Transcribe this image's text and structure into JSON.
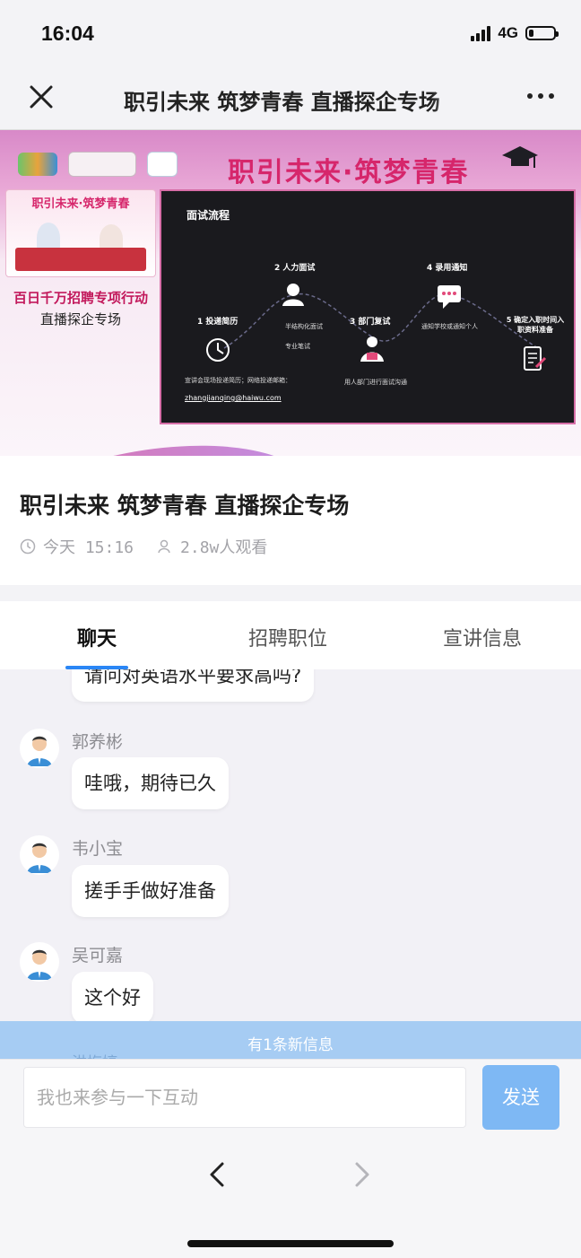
{
  "status_bar": {
    "time": "16:04",
    "network": "4G",
    "battery_level": 0.2
  },
  "nav": {
    "title": "职引未来 筑梦青春 直播探企专场",
    "close_icon": "close-icon",
    "more_icon": "more-dots-icon"
  },
  "banner": {
    "headline": "职引未来·筑梦青春",
    "thumb_title": "职引未来·筑梦青春",
    "subtitle_1": "百日千万招聘专项行动",
    "subtitle_2": "直播探企专场",
    "slide": {
      "title": "面试流程",
      "steps": [
        {
          "label": "1 投递简历",
          "icon": "clock-icon"
        },
        {
          "label": "2 人力面试",
          "icon": "interviewer-icon"
        },
        {
          "label": "3 部门复试",
          "icon": "team-icon"
        },
        {
          "label": "4 录用通知",
          "icon": "chat-icon"
        },
        {
          "label": "5 确定入职时间入职资料准备",
          "icon": "document-icon"
        }
      ],
      "notes": {
        "resume": "宣讲会现场投递简历；网络投递邮箱：",
        "email": "zhangjianqing@haiwu.com",
        "hr_1": "半结构化面试",
        "hr_2": "专业笔试",
        "dept": "用人部门进行面试沟通",
        "offer": "通知学校或通知个人"
      }
    }
  },
  "live": {
    "title": "职引未来 筑梦青春 直播探企专场",
    "time": "今天 15:16",
    "viewers": "2.8w人观看"
  },
  "tabs": [
    {
      "label": "聊天",
      "active": true
    },
    {
      "label": "招聘职位",
      "active": false
    },
    {
      "label": "宣讲信息",
      "active": false
    }
  ],
  "chat": {
    "partial_message": "请问对英语水平要求高吗?",
    "messages": [
      {
        "sender": "郭养彬",
        "text": "哇哦，期待已久"
      },
      {
        "sender": "韦小宝",
        "text": "搓手手做好准备"
      },
      {
        "sender": "吴可嘉",
        "text": "这个好"
      }
    ],
    "next_sender_partial": "洪梅婷"
  },
  "new_message_notice": "有1条新信息",
  "input": {
    "placeholder": "我也来参与一下互动",
    "send_label": "发送"
  },
  "browser": {
    "back_icon": "chevron-left-icon",
    "forward_icon": "chevron-right-icon"
  },
  "colors": {
    "accent": "#2a86f5",
    "send_button": "#7eb8f4",
    "notice_bar": "#a6ccf3",
    "banner_pink": "#d6266b"
  }
}
